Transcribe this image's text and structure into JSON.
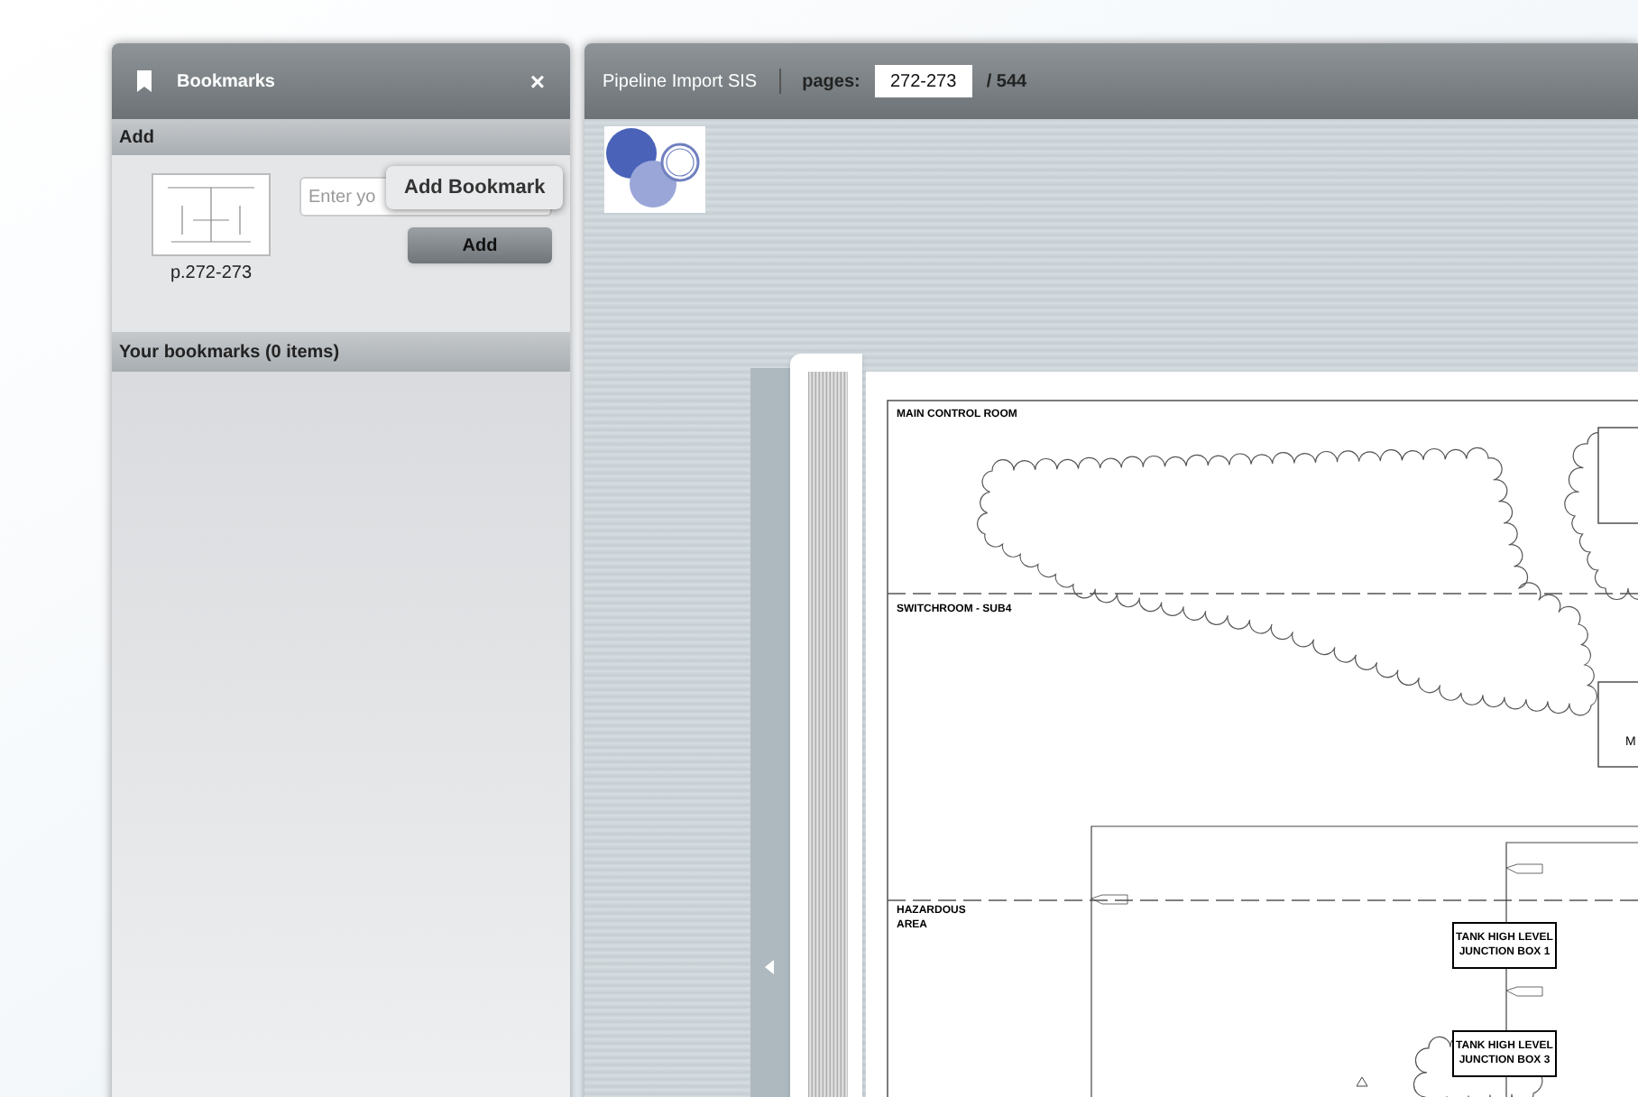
{
  "sidebar": {
    "title": "Bookmarks",
    "close": "×",
    "add_section": {
      "heading": "Add",
      "thumbnail_caption": "p.272-273",
      "input": {
        "placeholder": "Enter yo"
      },
      "button": "Add",
      "tooltip": "Add Bookmark"
    },
    "list_heading": "Your bookmarks (0 items)"
  },
  "viewer": {
    "title": "Pipeline Import SIS",
    "pages_label": "pages:",
    "pages_value": "272-273",
    "total": "/ 544",
    "document": {
      "labels": [
        {
          "kind": "zone",
          "text": "MAIN CONTROL ROOM"
        },
        {
          "kind": "zone",
          "text": "SWITCHROOM - SUB4"
        },
        {
          "kind": "zone",
          "text": "HAZARDOUS AREA"
        },
        {
          "kind": "box",
          "text": "TANK HIGH LEVEL JUNCTION BOX 1"
        },
        {
          "kind": "box",
          "text": "TANK HIGH LEVEL JUNCTION BOX 3"
        },
        {
          "kind": "edge",
          "text": "M"
        }
      ]
    }
  }
}
